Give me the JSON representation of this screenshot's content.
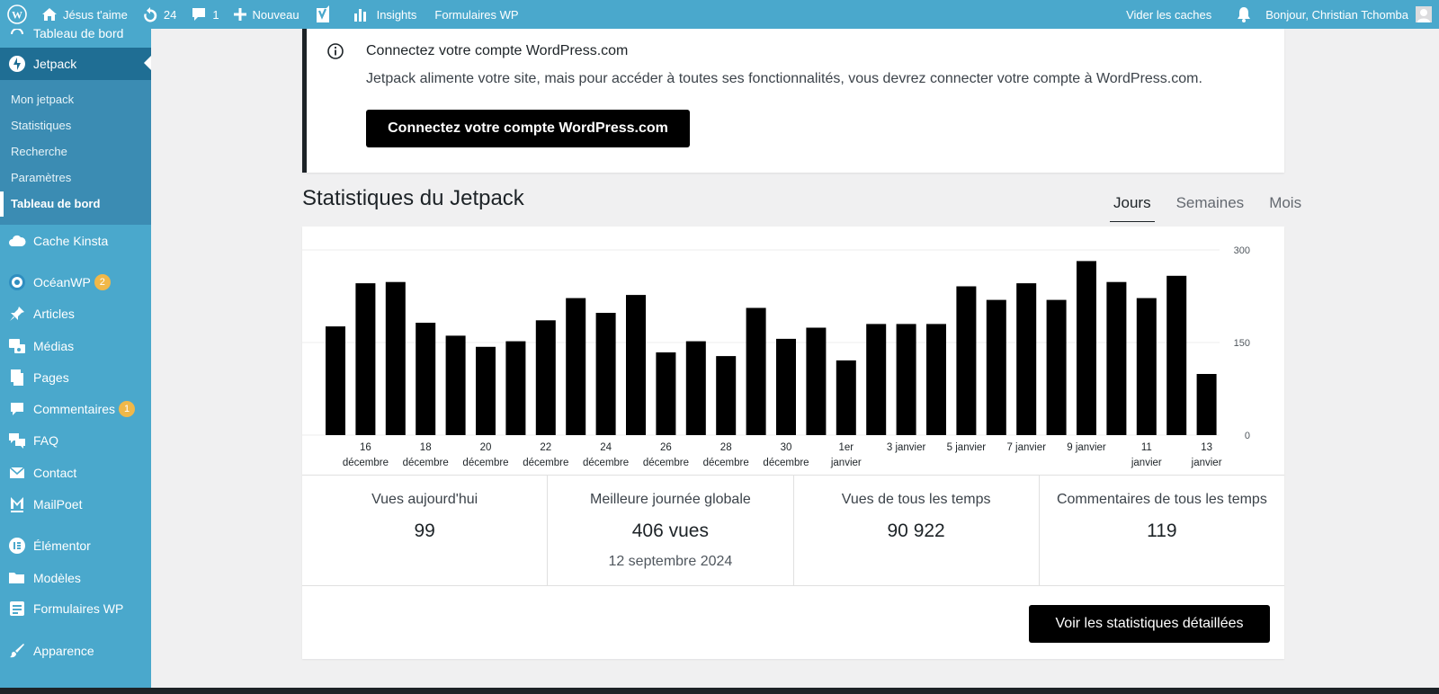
{
  "adminbar": {
    "site_name": "Jésus t'aime",
    "updates_count": "24",
    "comments_count": "1",
    "new_label": "Nouveau",
    "insights_label": "Insights",
    "forms_label": "Formulaires WP",
    "clear_cache_label": "Vider les caches",
    "greeting": "Bonjour, Christian Tchomba"
  },
  "sidebar": {
    "top_cut_label": "Tableau de bord",
    "jetpack_label": "Jetpack",
    "jetpack_sub": [
      "Mon jetpack",
      "Statistiques",
      "Recherche",
      "Paramètres",
      "Tableau de bord"
    ],
    "items": [
      {
        "label": "Cache Kinsta"
      },
      {
        "label": "OcéanWP",
        "badge": "2"
      },
      {
        "label": "Articles"
      },
      {
        "label": "Médias"
      },
      {
        "label": "Pages"
      },
      {
        "label": "Commentaires",
        "badge": "1"
      },
      {
        "label": "FAQ"
      },
      {
        "label": "Contact"
      },
      {
        "label": "MailPoet"
      },
      {
        "label": "Élémentor"
      },
      {
        "label": "Modèles"
      },
      {
        "label": "Formulaires WP"
      },
      {
        "label": "Apparence"
      }
    ]
  },
  "notice": {
    "title": "Connectez votre compte WordPress.com",
    "text": "Jetpack alimente votre site, mais pour accéder à toutes ses fonctionnalités, vous devrez connecter votre compte à WordPress.com.",
    "button": "Connectez votre compte WordPress.com"
  },
  "stats": {
    "title": "Statistiques du Jetpack",
    "tabs": [
      "Jours",
      "Semaines",
      "Mois"
    ],
    "active_tab": "Jours",
    "summary": {
      "today_label": "Vues aujourd'hui",
      "today_value": "99",
      "best_label": "Meilleure journée globale",
      "best_value": "406 vues",
      "best_date": "12 septembre 2024",
      "alltime_label": "Vues de tous les temps",
      "alltime_value": "90 922",
      "comments_label": "Commentaires de tous les temps",
      "comments_value": "119"
    },
    "details_button": "Voir les statistiques détaillées"
  },
  "chart_data": {
    "type": "bar",
    "y_ticks": [
      "300",
      "150",
      "0"
    ],
    "ylim": [
      0,
      300
    ],
    "x_tick_labels": [
      [
        "16",
        "décembre"
      ],
      [
        "18",
        "décembre"
      ],
      [
        "20",
        "décembre"
      ],
      [
        "22",
        "décembre"
      ],
      [
        "24",
        "décembre"
      ],
      [
        "26",
        "décembre"
      ],
      [
        "28",
        "décembre"
      ],
      [
        "30",
        "décembre"
      ],
      [
        "1er",
        "janvier"
      ],
      [
        "3 janvier",
        ""
      ],
      [
        "5 janvier",
        ""
      ],
      [
        "7 janvier",
        ""
      ],
      [
        "9 janvier",
        ""
      ],
      [
        "11",
        "janvier"
      ],
      [
        "13",
        "janvier"
      ]
    ],
    "values": [
      176,
      246,
      248,
      182,
      161,
      143,
      152,
      186,
      222,
      198,
      227,
      134,
      152,
      128,
      206,
      156,
      174,
      121,
      180,
      180,
      180,
      241,
      219,
      246,
      219,
      282,
      248,
      222,
      258,
      99
    ],
    "bar_color": "#000000",
    "grid": true
  }
}
